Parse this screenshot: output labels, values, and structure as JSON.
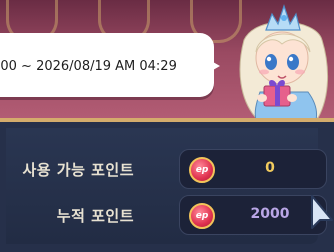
{
  "bubble": {
    "text": ":00 ~ 2026/08/19 AM 04:29"
  },
  "points": {
    "available_label": "사용 가능 포인트",
    "available_value": "0",
    "cumulative_label": "누적 포인트",
    "cumulative_value": "2000",
    "icon_text": "ep"
  },
  "icons": {
    "point_icon": "ep-coin-icon",
    "cursor": "mouse-cursor-icon",
    "character": "princess-character-illustration"
  },
  "colors": {
    "available_value": "#f2cc5e",
    "cumulative_value": "#b9a6e6",
    "panel_border": "#d4ac6c",
    "icon_red": "#e0324f"
  }
}
